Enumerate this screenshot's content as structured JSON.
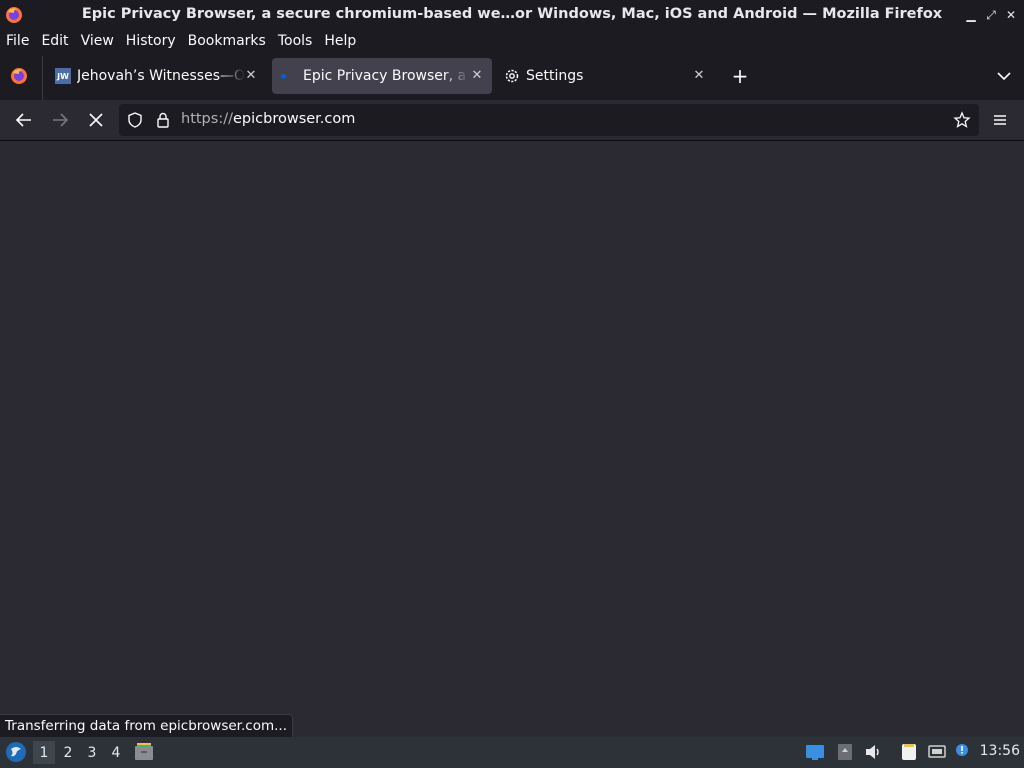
{
  "window": {
    "title": "Epic Privacy Browser, a secure chromium-based we…or Windows, Mac, iOS and Android — Mozilla Firefox"
  },
  "menubar": {
    "items": [
      {
        "label": "File"
      },
      {
        "label": "Edit"
      },
      {
        "label": "View"
      },
      {
        "label": "History"
      },
      {
        "label": "Bookmarks"
      },
      {
        "label": "Tools"
      },
      {
        "label": "Help"
      }
    ]
  },
  "tabs": [
    {
      "label": "Jehovah’s Witnesses—Official Website",
      "favicon_text": "JW",
      "active": false
    },
    {
      "label": "Epic Privacy Browser, a secure chromium-based web browser",
      "active": true,
      "loading": true
    },
    {
      "label": "Settings",
      "active": false
    }
  ],
  "navbar": {
    "url_scheme": "https://",
    "url_host": "epicbrowser.com"
  },
  "status": {
    "text": "Transferring data from epicbrowser.com..."
  },
  "taskbar": {
    "workspaces": [
      "1",
      "2",
      "3",
      "4"
    ],
    "active_workspace": "1",
    "clock": "13:56"
  },
  "colors": {
    "chrome_bg": "#1c1b22",
    "toolbar_bg": "#2b2a33",
    "active_tab_bg": "#42414d",
    "accent": "#0060df",
    "taskbar_bg": "#2d3238"
  }
}
